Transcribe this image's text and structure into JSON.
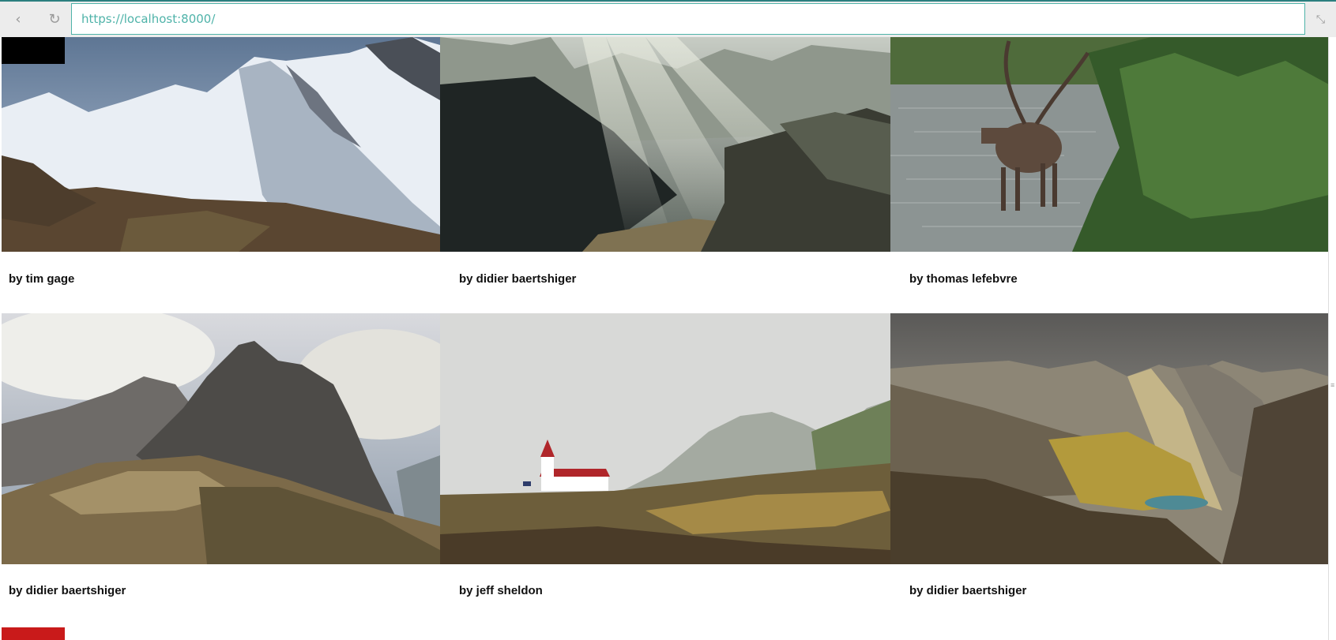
{
  "browser": {
    "url": "https://localhost:8000/",
    "back_icon": "‹",
    "reload_icon": "↻",
    "shrink_icon": "⤡"
  },
  "gallery": {
    "items": [
      {
        "caption": "by tim gage"
      },
      {
        "caption": "by didier baertshiger"
      },
      {
        "caption": "by thomas lefebvre"
      },
      {
        "caption": "by didier baertshiger"
      },
      {
        "caption": "by jeff sheldon"
      },
      {
        "caption": "by didier baertshiger"
      }
    ]
  }
}
